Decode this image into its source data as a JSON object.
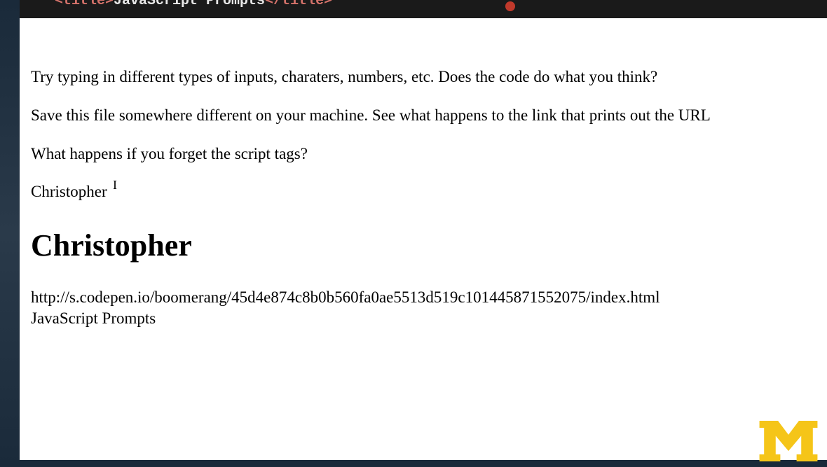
{
  "editor": {
    "tag_open": "<title>",
    "title_text": "JavaScript Prompts",
    "tag_close": "</title>"
  },
  "content": {
    "paragraph1": "Try typing in different types of inputs, charaters, numbers, etc. Does the code do what you think?",
    "paragraph2": "Save this file somewhere different on your machine. See what happens to the link that prints out the URL",
    "paragraph3": "What happens if you forget the script tags?",
    "name_small": "Christopher",
    "name_heading": "Christopher",
    "url": "http://s.codepen.io/boomerang/45d4e874c8b0b560fa0ae5513d519c101445871552075/index.html",
    "page_title": "JavaScript Prompts"
  },
  "logo": {
    "label": "M"
  }
}
